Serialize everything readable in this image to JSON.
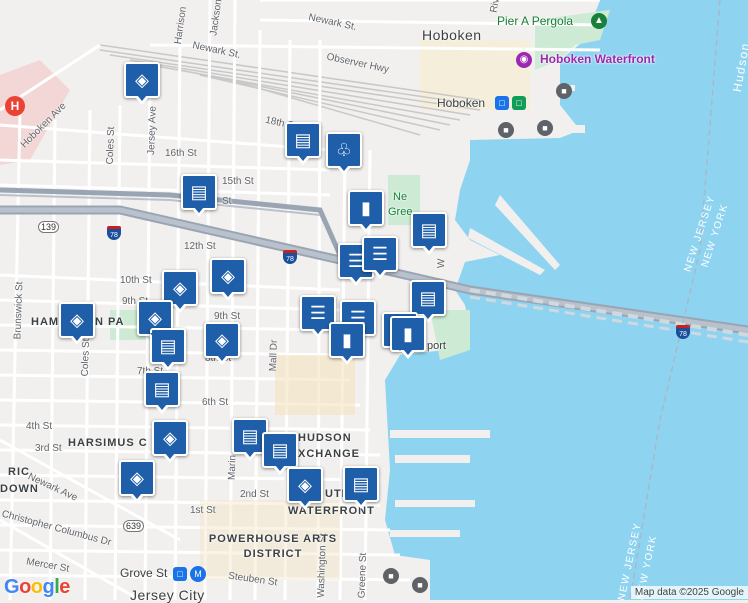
{
  "map": {
    "colors": {
      "land": "#f2f0ee",
      "water": "#8ed4f0",
      "park": "#cdebd4",
      "rail": "#c8c8c8",
      "road": "#ffffff",
      "highway": "#9aa5b4",
      "accent": "#1f5fa9"
    },
    "street_labels": [
      "Newark St.",
      "Jackson",
      "Harrison",
      "Observer Hwy",
      "18th St",
      "16th St",
      "15th St",
      "14th St",
      "12th St",
      "10th St",
      "9th St",
      "8th St",
      "7th St",
      "6th St",
      "4th St",
      "3rd St",
      "2nd St",
      "1st St",
      "Hoboken Ave",
      "Coles St",
      "Jersey Ave",
      "Brunswick St",
      "Newark Ave",
      "Christopher Columbus Dr",
      "Mercer St",
      "Steuben St",
      "Mall Dr",
      "Marin",
      "Washington St",
      "Greene St",
      "Riv"
    ],
    "district_labels": [
      "Hoboken",
      "HAMILTON PARK",
      "HARSIMUS COVE",
      "HISTORIC DOWNTOWN",
      "HUDSON EXCHANGE",
      "PAULUS HOOK / WATERFRONT",
      "POWERHOUSE ARTS DISTRICT",
      "Jersey City"
    ],
    "poi_labels": [
      "Pier A Pergola",
      "Hoboken Waterfront",
      "Hoboken Terminal",
      "Newport",
      "Grove St",
      "Newport Green"
    ],
    "state_labels": [
      "NEW JERSEY",
      "NEW YORK",
      "Hudson"
    ],
    "route_labels": [
      "139",
      "78",
      "639"
    ],
    "truncated_labels": {
      "newport_green_top": "Ne",
      "newport_green_bottom": "Gree",
      "newport_suffix": "port",
      "hamilton_left": "HAM",
      "hamilton_right": "N PA",
      "paulus_left": "UTH",
      "paulus_right": "WATERFRONT",
      "historic_left": "RIC",
      "historic_mid": "DOWN",
      "harsimus_left": "HARSIMUS C",
      "exchange_suffix": "XCHANGE",
      "hudson_suffix": "HUDSON",
      "st_suffix": "St",
      "hoboken_ave": "Hoboken Ave",
      "marin_short": "Marin",
      "w_street": "W",
      "grove_st": "Grove St"
    },
    "attribution": "Map data ©2025 Google",
    "logo": "Google"
  },
  "markers": [
    {
      "icon": "school",
      "label": "school-marker"
    },
    {
      "icon": "grocery",
      "label": "grocery-marker"
    },
    {
      "icon": "cafe",
      "label": "cafe-marker"
    },
    {
      "icon": "grocery",
      "label": "grocery-marker"
    },
    {
      "icon": "shopping",
      "label": "shopping-marker"
    },
    {
      "icon": "grocery",
      "label": "grocery-marker"
    },
    {
      "icon": "restaurant",
      "label": "restaurant-marker"
    },
    {
      "icon": "restaurant",
      "label": "restaurant-marker"
    },
    {
      "icon": "school",
      "label": "school-marker"
    },
    {
      "icon": "school",
      "label": "school-marker"
    },
    {
      "icon": "school",
      "label": "school-marker"
    },
    {
      "icon": "school",
      "label": "school-marker"
    },
    {
      "icon": "grocery",
      "label": "grocery-marker"
    },
    {
      "icon": "school",
      "label": "school-marker"
    },
    {
      "icon": "grocery",
      "label": "grocery-marker"
    },
    {
      "icon": "grocery",
      "label": "grocery-marker"
    },
    {
      "icon": "restaurant",
      "label": "restaurant-marker"
    },
    {
      "icon": "shopping",
      "label": "shopping-marker"
    },
    {
      "icon": "restaurant",
      "label": "restaurant-marker"
    },
    {
      "icon": "shopping",
      "label": "shopping-marker"
    },
    {
      "icon": "shopping",
      "label": "shopping-marker"
    },
    {
      "icon": "school",
      "label": "school-marker"
    },
    {
      "icon": "grocery",
      "label": "grocery-marker"
    },
    {
      "icon": "grocery",
      "label": "grocery-marker"
    },
    {
      "icon": "school",
      "label": "school-marker"
    },
    {
      "icon": "school",
      "label": "school-marker"
    },
    {
      "icon": "grocery",
      "label": "grocery-marker"
    }
  ]
}
